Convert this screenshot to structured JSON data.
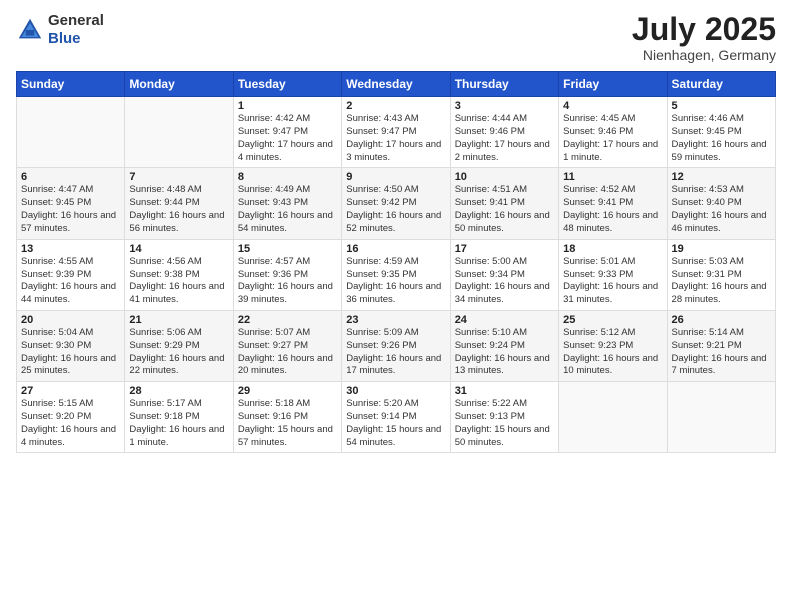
{
  "header": {
    "logo_general": "General",
    "logo_blue": "Blue",
    "title": "July 2025",
    "subtitle": "Nienhagen, Germany"
  },
  "days_of_week": [
    "Sunday",
    "Monday",
    "Tuesday",
    "Wednesday",
    "Thursday",
    "Friday",
    "Saturday"
  ],
  "weeks": [
    [
      {
        "day": "",
        "info": ""
      },
      {
        "day": "",
        "info": ""
      },
      {
        "day": "1",
        "info": "Sunrise: 4:42 AM\nSunset: 9:47 PM\nDaylight: 17 hours\nand 4 minutes."
      },
      {
        "day": "2",
        "info": "Sunrise: 4:43 AM\nSunset: 9:47 PM\nDaylight: 17 hours\nand 3 minutes."
      },
      {
        "day": "3",
        "info": "Sunrise: 4:44 AM\nSunset: 9:46 PM\nDaylight: 17 hours\nand 2 minutes."
      },
      {
        "day": "4",
        "info": "Sunrise: 4:45 AM\nSunset: 9:46 PM\nDaylight: 17 hours\nand 1 minute."
      },
      {
        "day": "5",
        "info": "Sunrise: 4:46 AM\nSunset: 9:45 PM\nDaylight: 16 hours\nand 59 minutes."
      }
    ],
    [
      {
        "day": "6",
        "info": "Sunrise: 4:47 AM\nSunset: 9:45 PM\nDaylight: 16 hours\nand 57 minutes."
      },
      {
        "day": "7",
        "info": "Sunrise: 4:48 AM\nSunset: 9:44 PM\nDaylight: 16 hours\nand 56 minutes."
      },
      {
        "day": "8",
        "info": "Sunrise: 4:49 AM\nSunset: 9:43 PM\nDaylight: 16 hours\nand 54 minutes."
      },
      {
        "day": "9",
        "info": "Sunrise: 4:50 AM\nSunset: 9:42 PM\nDaylight: 16 hours\nand 52 minutes."
      },
      {
        "day": "10",
        "info": "Sunrise: 4:51 AM\nSunset: 9:41 PM\nDaylight: 16 hours\nand 50 minutes."
      },
      {
        "day": "11",
        "info": "Sunrise: 4:52 AM\nSunset: 9:41 PM\nDaylight: 16 hours\nand 48 minutes."
      },
      {
        "day": "12",
        "info": "Sunrise: 4:53 AM\nSunset: 9:40 PM\nDaylight: 16 hours\nand 46 minutes."
      }
    ],
    [
      {
        "day": "13",
        "info": "Sunrise: 4:55 AM\nSunset: 9:39 PM\nDaylight: 16 hours\nand 44 minutes."
      },
      {
        "day": "14",
        "info": "Sunrise: 4:56 AM\nSunset: 9:38 PM\nDaylight: 16 hours\nand 41 minutes."
      },
      {
        "day": "15",
        "info": "Sunrise: 4:57 AM\nSunset: 9:36 PM\nDaylight: 16 hours\nand 39 minutes."
      },
      {
        "day": "16",
        "info": "Sunrise: 4:59 AM\nSunset: 9:35 PM\nDaylight: 16 hours\nand 36 minutes."
      },
      {
        "day": "17",
        "info": "Sunrise: 5:00 AM\nSunset: 9:34 PM\nDaylight: 16 hours\nand 34 minutes."
      },
      {
        "day": "18",
        "info": "Sunrise: 5:01 AM\nSunset: 9:33 PM\nDaylight: 16 hours\nand 31 minutes."
      },
      {
        "day": "19",
        "info": "Sunrise: 5:03 AM\nSunset: 9:31 PM\nDaylight: 16 hours\nand 28 minutes."
      }
    ],
    [
      {
        "day": "20",
        "info": "Sunrise: 5:04 AM\nSunset: 9:30 PM\nDaylight: 16 hours\nand 25 minutes."
      },
      {
        "day": "21",
        "info": "Sunrise: 5:06 AM\nSunset: 9:29 PM\nDaylight: 16 hours\nand 22 minutes."
      },
      {
        "day": "22",
        "info": "Sunrise: 5:07 AM\nSunset: 9:27 PM\nDaylight: 16 hours\nand 20 minutes."
      },
      {
        "day": "23",
        "info": "Sunrise: 5:09 AM\nSunset: 9:26 PM\nDaylight: 16 hours\nand 17 minutes."
      },
      {
        "day": "24",
        "info": "Sunrise: 5:10 AM\nSunset: 9:24 PM\nDaylight: 16 hours\nand 13 minutes."
      },
      {
        "day": "25",
        "info": "Sunrise: 5:12 AM\nSunset: 9:23 PM\nDaylight: 16 hours\nand 10 minutes."
      },
      {
        "day": "26",
        "info": "Sunrise: 5:14 AM\nSunset: 9:21 PM\nDaylight: 16 hours\nand 7 minutes."
      }
    ],
    [
      {
        "day": "27",
        "info": "Sunrise: 5:15 AM\nSunset: 9:20 PM\nDaylight: 16 hours\nand 4 minutes."
      },
      {
        "day": "28",
        "info": "Sunrise: 5:17 AM\nSunset: 9:18 PM\nDaylight: 16 hours\nand 1 minute."
      },
      {
        "day": "29",
        "info": "Sunrise: 5:18 AM\nSunset: 9:16 PM\nDaylight: 15 hours\nand 57 minutes."
      },
      {
        "day": "30",
        "info": "Sunrise: 5:20 AM\nSunset: 9:14 PM\nDaylight: 15 hours\nand 54 minutes."
      },
      {
        "day": "31",
        "info": "Sunrise: 5:22 AM\nSunset: 9:13 PM\nDaylight: 15 hours\nand 50 minutes."
      },
      {
        "day": "",
        "info": ""
      },
      {
        "day": "",
        "info": ""
      }
    ]
  ]
}
